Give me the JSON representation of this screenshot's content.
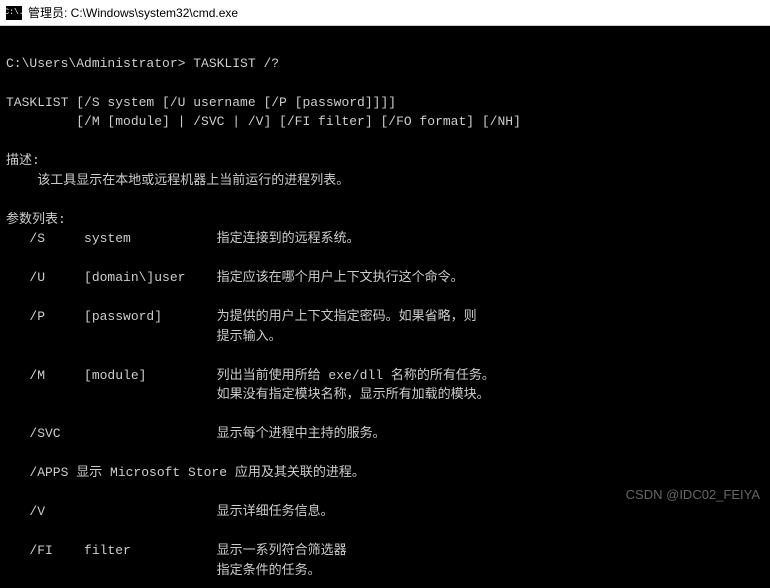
{
  "titlebar": {
    "icon_text": "C:\\.",
    "title": "管理员: C:\\Windows\\system32\\cmd.exe"
  },
  "terminal": {
    "prompt": "C:\\Users\\Administrator> TASKLIST /?",
    "usage1": "TASKLIST [/S system [/U username [/P [password]]]]",
    "usage2": "         [/M [module] | /SVC | /V] [/FI filter] [/FO format] [/NH]",
    "desc_header": "描述:",
    "desc_body": "    该工具显示在本地或远程机器上当前运行的进程列表。",
    "params_header": "参数列表:",
    "p_s": "   /S     system           指定连接到的远程系统。",
    "p_u": "   /U     [domain\\]user    指定应该在哪个用户上下文执行这个命令。",
    "p_p1": "   /P     [password]       为提供的用户上下文指定密码。如果省略，则",
    "p_p2": "                           提示输入。",
    "p_m1": "   /M     [module]         列出当前使用所给 exe/dll 名称的所有任务。",
    "p_m2": "                           如果没有指定模块名称，显示所有加载的模块。",
    "p_svc": "   /SVC                    显示每个进程中主持的服务。",
    "p_apps": "   /APPS 显示 Microsoft Store 应用及其关联的进程。",
    "p_v": "   /V                      显示详细任务信息。",
    "p_fi1": "   /FI    filter           显示一系列符合筛选器",
    "p_fi2": "                           指定条件的任务。"
  },
  "watermark": "CSDN @IDC02_FEIYA"
}
